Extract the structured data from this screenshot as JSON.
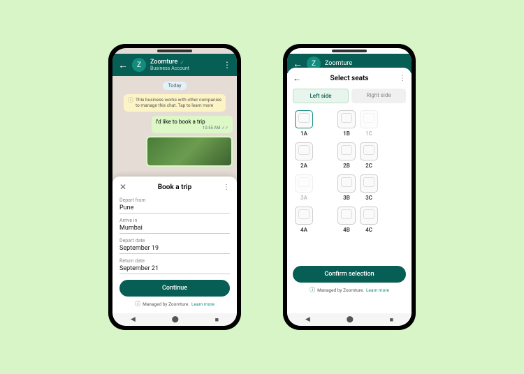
{
  "phone1": {
    "header": {
      "name": "Zoomture",
      "subtitle": "Business Account"
    },
    "chat": {
      "date": "Today",
      "system_msg": "This business works with other companies to manage this chat. Tap to learn more",
      "outgoing": "I'd like to book a trip",
      "time": "10:55 AM ✓✓"
    },
    "sheet": {
      "title": "Book a trip",
      "fields": [
        {
          "label": "Depart from",
          "value": "Pune"
        },
        {
          "label": "Arrive in",
          "value": "Mumbai"
        },
        {
          "label": "Depart date",
          "value": "September 19"
        },
        {
          "label": "Return date",
          "value": "September 21"
        }
      ],
      "button": "Continue",
      "managed": "Managed by Zoomture.",
      "learn_more": "Learn more"
    }
  },
  "phone2": {
    "header": {
      "name": "Zoomture"
    },
    "sheet": {
      "title": "Select seats",
      "tabs": {
        "left": "Left side",
        "right": "Right side"
      },
      "seats": [
        [
          {
            "id": "1A",
            "state": "selected"
          },
          {
            "id": "1B",
            "state": "normal"
          },
          {
            "id": "1C",
            "state": "disabled"
          }
        ],
        [
          {
            "id": "2A",
            "state": "normal"
          },
          {
            "id": "2B",
            "state": "normal"
          },
          {
            "id": "2C",
            "state": "normal"
          }
        ],
        [
          {
            "id": "3A",
            "state": "disabled"
          },
          {
            "id": "3B",
            "state": "normal"
          },
          {
            "id": "3C",
            "state": "normal"
          }
        ],
        [
          {
            "id": "4A",
            "state": "normal"
          },
          {
            "id": "4B",
            "state": "normal"
          },
          {
            "id": "4C",
            "state": "normal"
          }
        ]
      ],
      "button": "Confirm selection",
      "managed": "Managed by Zoomture.",
      "learn_more": "Learn more"
    }
  }
}
